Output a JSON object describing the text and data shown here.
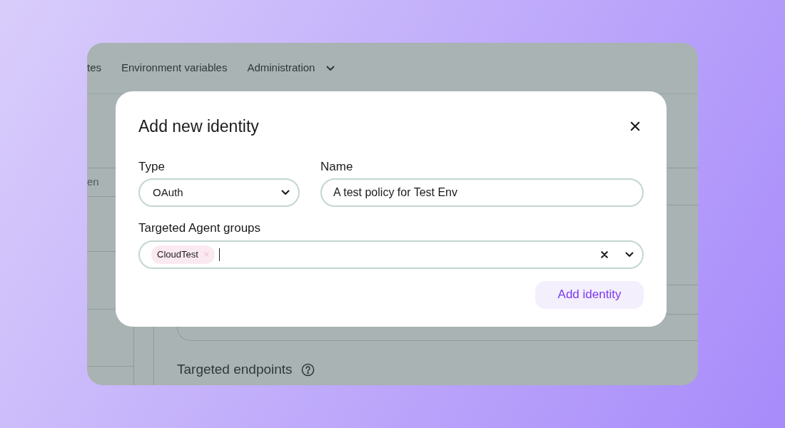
{
  "background": {
    "nav": [
      {
        "label": "tes"
      },
      {
        "label": "Environment variables"
      },
      {
        "label": "Administration",
        "has_menu": true
      }
    ],
    "search_field": {
      "placeholder": "en"
    },
    "section_title": "Targeted endpoints"
  },
  "dialog": {
    "title": "Add new identity",
    "type": {
      "label": "Type",
      "value": "OAuth"
    },
    "name": {
      "label": "Name",
      "value": "A test policy for Test Env"
    },
    "groups": {
      "label": "Targeted Agent groups",
      "chips": [
        "CloudTest"
      ]
    },
    "submit": "Add identity"
  }
}
